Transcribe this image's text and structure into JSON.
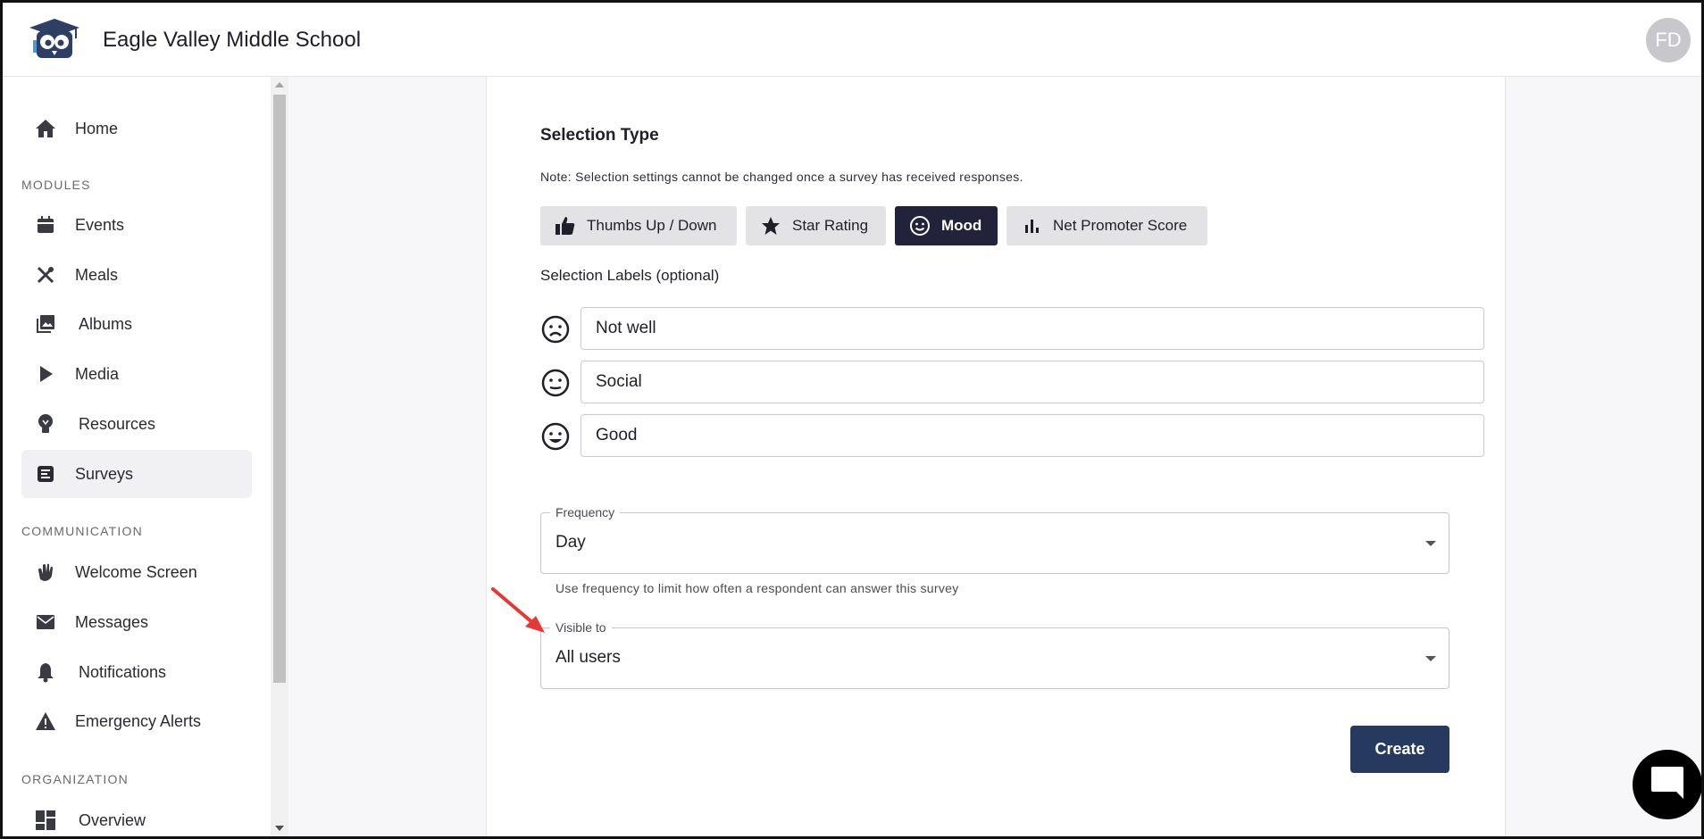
{
  "header": {
    "school_name": "Eagle Valley Middle School",
    "avatar_initials": "FD"
  },
  "sidebar": {
    "home": {
      "label": "Home",
      "icon": "home-icon"
    },
    "sections": {
      "modules": "MODULES",
      "communication": "COMMUNICATION",
      "organization": "ORGANIZATION"
    },
    "modules": [
      {
        "label": "Events",
        "icon": "calendar-icon"
      },
      {
        "label": "Meals",
        "icon": "utensils-icon"
      },
      {
        "label": "Albums",
        "icon": "photo-album-icon"
      },
      {
        "label": "Media",
        "icon": "play-icon"
      },
      {
        "label": "Resources",
        "icon": "lightbulb-icon"
      },
      {
        "label": "Surveys",
        "icon": "survey-icon",
        "active": true
      }
    ],
    "communication": [
      {
        "label": "Welcome Screen",
        "icon": "wave-icon"
      },
      {
        "label": "Messages",
        "icon": "envelope-icon"
      },
      {
        "label": "Notifications",
        "icon": "bell-icon"
      },
      {
        "label": "Emergency Alerts",
        "icon": "warning-icon"
      }
    ],
    "organization": [
      {
        "label": "Overview",
        "icon": "dashboard-icon"
      }
    ]
  },
  "form": {
    "selection_type_title": "Selection Type",
    "note": "Note: Selection settings cannot be changed once a survey has received responses.",
    "selection_options": [
      {
        "label": "Thumbs Up / Down",
        "icon": "thumbs-up-icon",
        "selected": false
      },
      {
        "label": "Star Rating",
        "icon": "star-icon",
        "selected": false
      },
      {
        "label": "Mood",
        "icon": "smiley-icon",
        "selected": true
      },
      {
        "label": "Net Promoter Score",
        "icon": "bar-chart-icon",
        "selected": false
      }
    ],
    "selection_labels_title": "Selection Labels (optional)",
    "labels": [
      {
        "value": "Not well",
        "icon": "sad-face-icon"
      },
      {
        "value": "Social",
        "icon": "neutral-face-icon"
      },
      {
        "value": "Good",
        "icon": "happy-face-icon"
      }
    ],
    "frequency": {
      "label": "Frequency",
      "value": "Day",
      "helper": "Use frequency to limit how often a respondent can answer this survey"
    },
    "visible_to": {
      "label": "Visible to",
      "value": "All users"
    },
    "create_label": "Create"
  },
  "colors": {
    "active_segment": "#22223a",
    "create_button": "#26395e",
    "annotation_arrow": "#e53935"
  }
}
